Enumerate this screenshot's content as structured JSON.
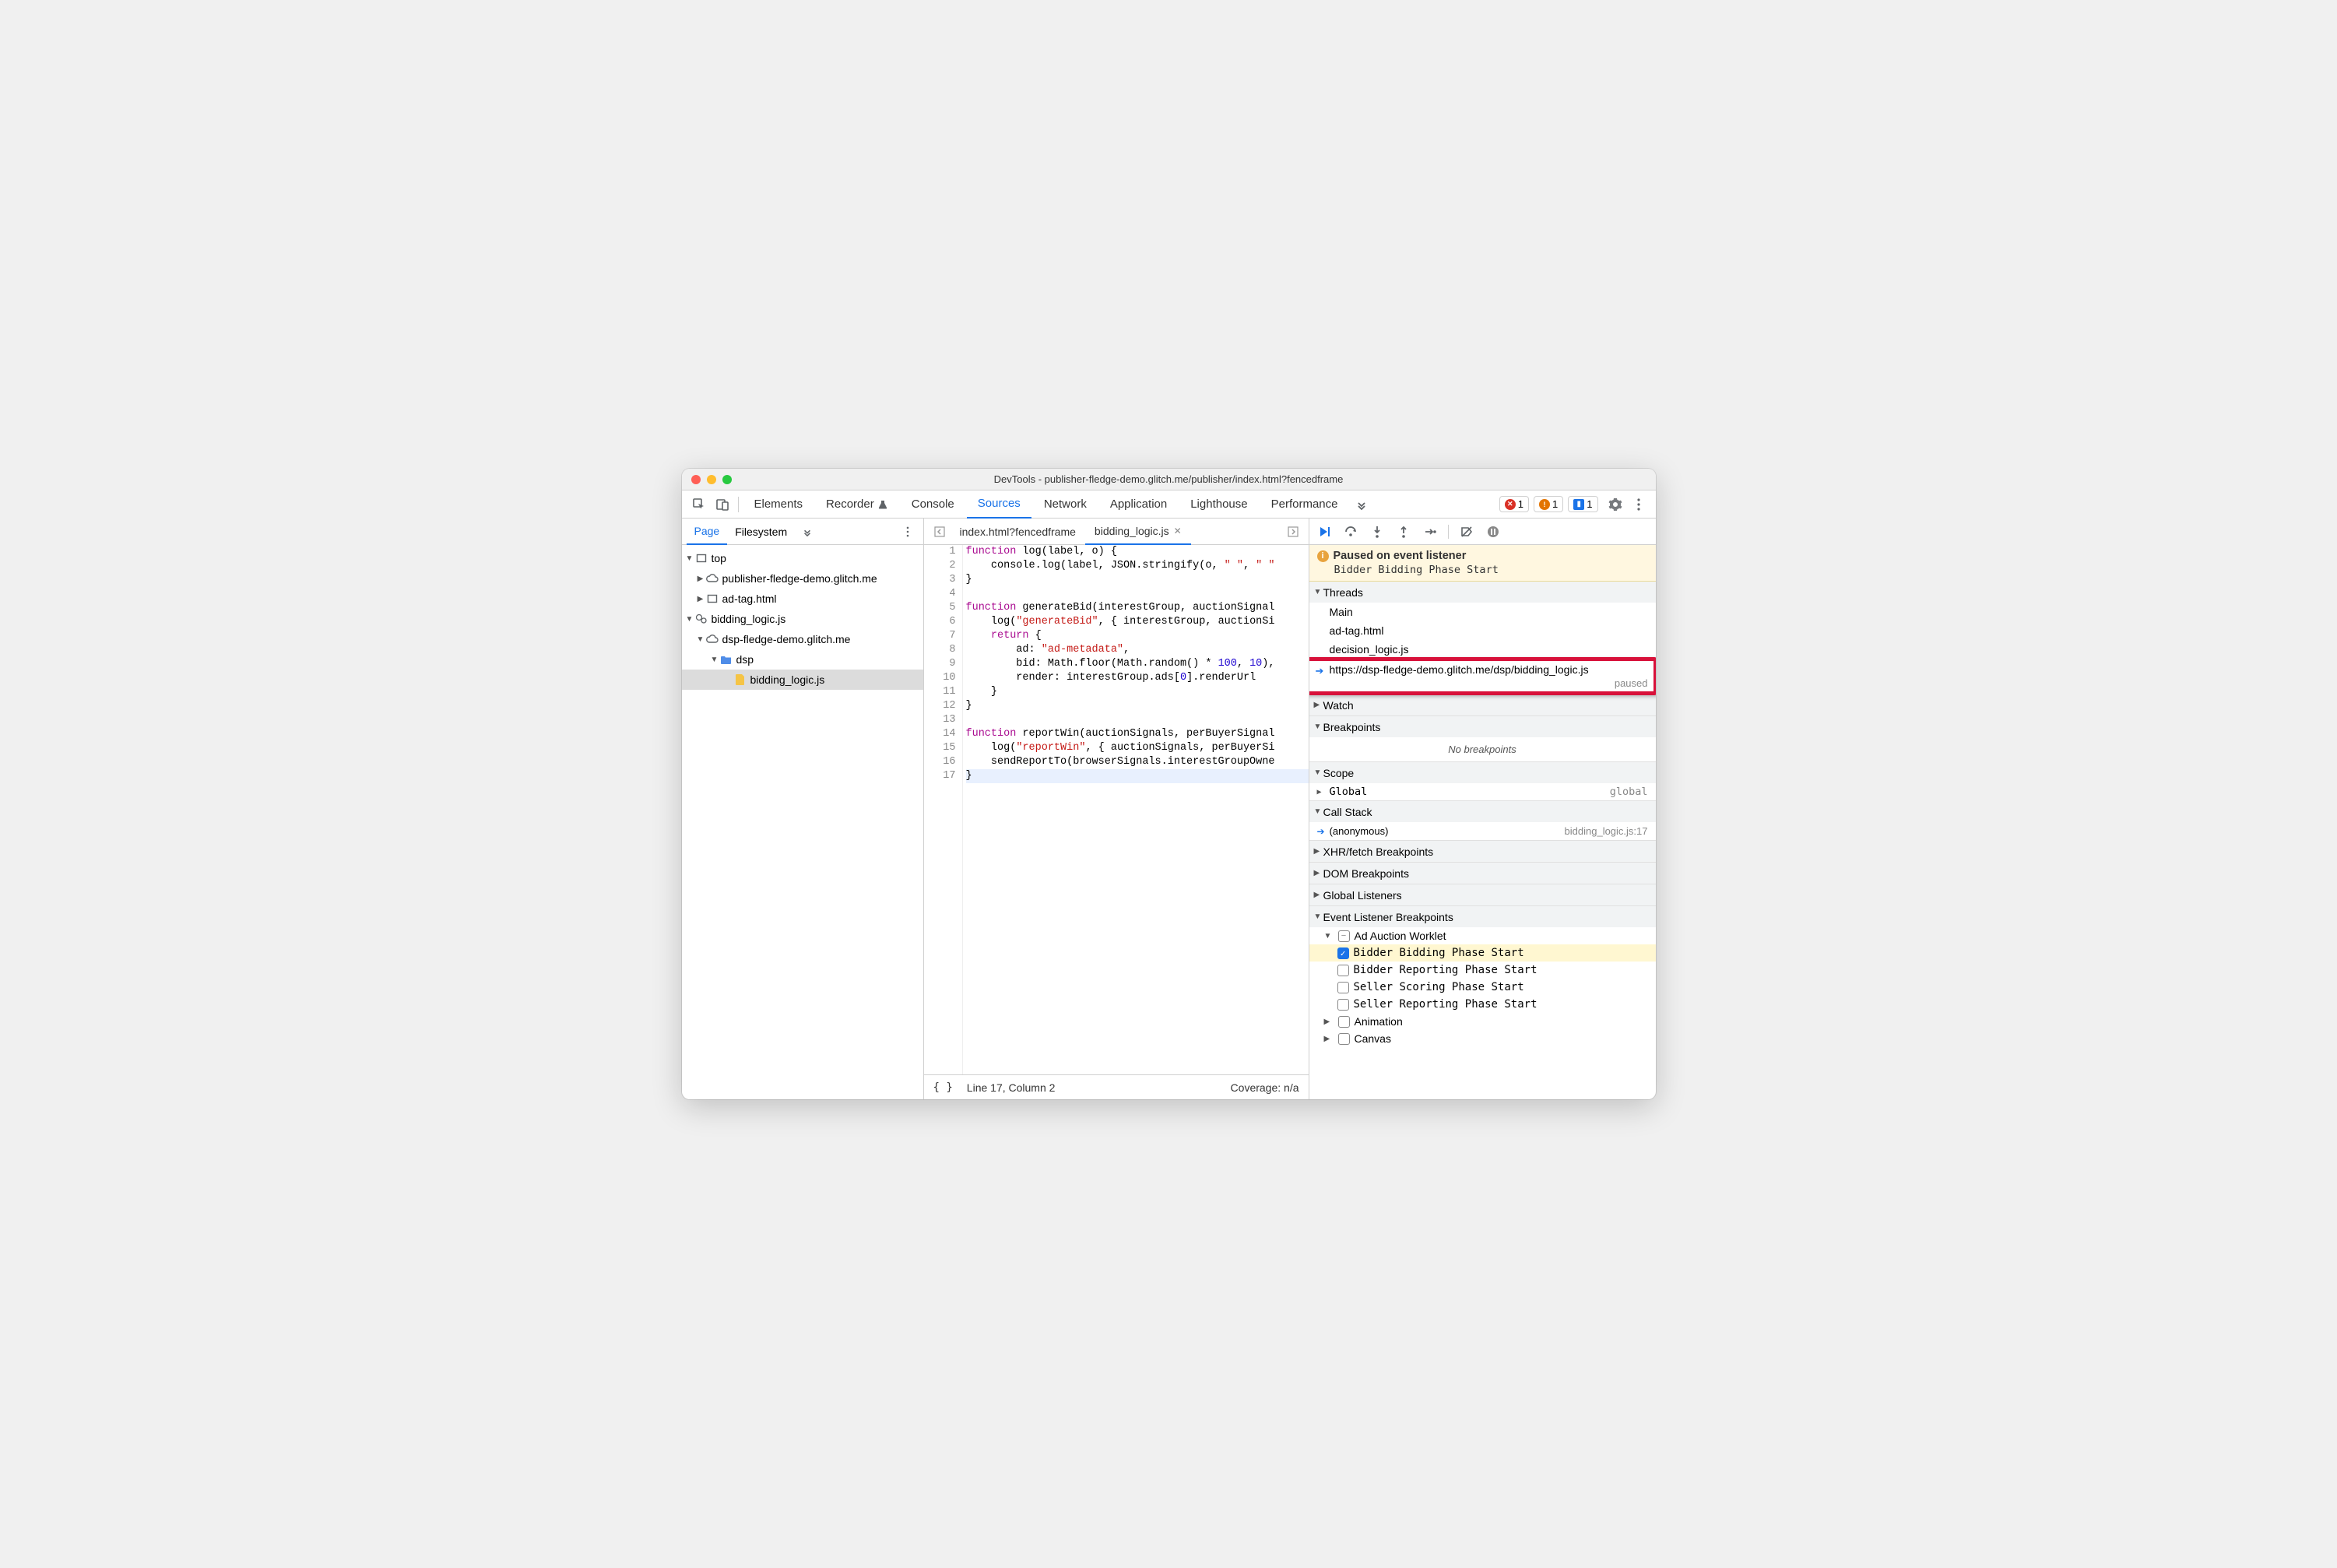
{
  "window": {
    "title": "DevTools - publisher-fledge-demo.glitch.me/publisher/index.html?fencedframe"
  },
  "main_tabs": [
    "Elements",
    "Recorder",
    "Console",
    "Sources",
    "Network",
    "Application",
    "Lighthouse",
    "Performance"
  ],
  "main_tabs_active": "Sources",
  "badges": {
    "errors": "1",
    "warnings": "1",
    "issues": "1"
  },
  "left": {
    "tabs": [
      "Page",
      "Filesystem"
    ],
    "active": "Page",
    "tree": {
      "top": "top",
      "pub_domain": "publisher-fledge-demo.glitch.me",
      "ad_tag": "ad-tag.html",
      "bidding_worklet": "bidding_logic.js",
      "dsp_domain": "dsp-fledge-demo.glitch.me",
      "dsp_folder": "dsp",
      "bidding_file": "bidding_logic.js"
    }
  },
  "editor": {
    "tabs": [
      {
        "label": "index.html?fencedframe",
        "active": false
      },
      {
        "label": "bidding_logic.js",
        "active": true
      }
    ],
    "code_lines": [
      {
        "n": 1,
        "html": "<span class='kw'>function</span> log(label, o) {"
      },
      {
        "n": 2,
        "html": "    console.log(label, JSON.stringify(o, <span class='str'>\" \"</span>, <span class='str'>\" \"</span>"
      },
      {
        "n": 3,
        "html": "}"
      },
      {
        "n": 4,
        "html": ""
      },
      {
        "n": 5,
        "html": "<span class='kw'>function</span> generateBid(interestGroup, auctionSignal"
      },
      {
        "n": 6,
        "html": "    log(<span class='str'>\"generateBid\"</span>, { interestGroup, auctionSi"
      },
      {
        "n": 7,
        "html": "    <span class='kw'>return</span> {"
      },
      {
        "n": 8,
        "html": "        ad: <span class='str'>\"ad-metadata\"</span>,"
      },
      {
        "n": 9,
        "html": "        bid: Math.floor(Math.random() * <span class='num'>100</span>, <span class='num'>10</span>),"
      },
      {
        "n": 10,
        "html": "        render: interestGroup.ads[<span class='num'>0</span>].renderUrl"
      },
      {
        "n": 11,
        "html": "    }"
      },
      {
        "n": 12,
        "html": "}"
      },
      {
        "n": 13,
        "html": ""
      },
      {
        "n": 14,
        "html": "<span class='kw'>function</span> reportWin(auctionSignals, perBuyerSignal"
      },
      {
        "n": 15,
        "html": "    log(<span class='str'>\"reportWin\"</span>, { auctionSignals, perBuyerSi"
      },
      {
        "n": 16,
        "html": "    sendReportTo(browserSignals.interestGroupOwne"
      },
      {
        "n": 17,
        "html": "}",
        "cursor": true
      }
    ],
    "status": {
      "format": "{ }",
      "pos": "Line 17, Column 2",
      "coverage": "Coverage: n/a"
    }
  },
  "debugger": {
    "paused": {
      "title": "Paused on event listener",
      "detail": "Bidder Bidding Phase Start"
    },
    "sections": {
      "threads": {
        "title": "Threads",
        "items": [
          "Main",
          "ad-tag.html",
          "decision_logic.js"
        ],
        "active_url": "https://dsp-fledge-demo.glitch.me/dsp/bidding_logic.js",
        "active_state": "paused"
      },
      "watch": {
        "title": "Watch"
      },
      "breakpoints": {
        "title": "Breakpoints",
        "empty": "No breakpoints"
      },
      "scope": {
        "title": "Scope",
        "global_label": "Global",
        "global_value": "global"
      },
      "callstack": {
        "title": "Call Stack",
        "frame": "(anonymous)",
        "loc": "bidding_logic.js:17"
      },
      "xhr": {
        "title": "XHR/fetch Breakpoints"
      },
      "dom": {
        "title": "DOM Breakpoints"
      },
      "globall": {
        "title": "Global Listeners"
      },
      "elb": {
        "title": "Event Listener Breakpoints",
        "category": "Ad Auction Worklet",
        "items": [
          {
            "label": "Bidder Bidding Phase Start",
            "checked": true,
            "hit": true
          },
          {
            "label": "Bidder Reporting Phase Start",
            "checked": false
          },
          {
            "label": "Seller Scoring Phase Start",
            "checked": false
          },
          {
            "label": "Seller Reporting Phase Start",
            "checked": false
          }
        ],
        "other_categories": [
          "Animation",
          "Canvas"
        ]
      }
    }
  }
}
